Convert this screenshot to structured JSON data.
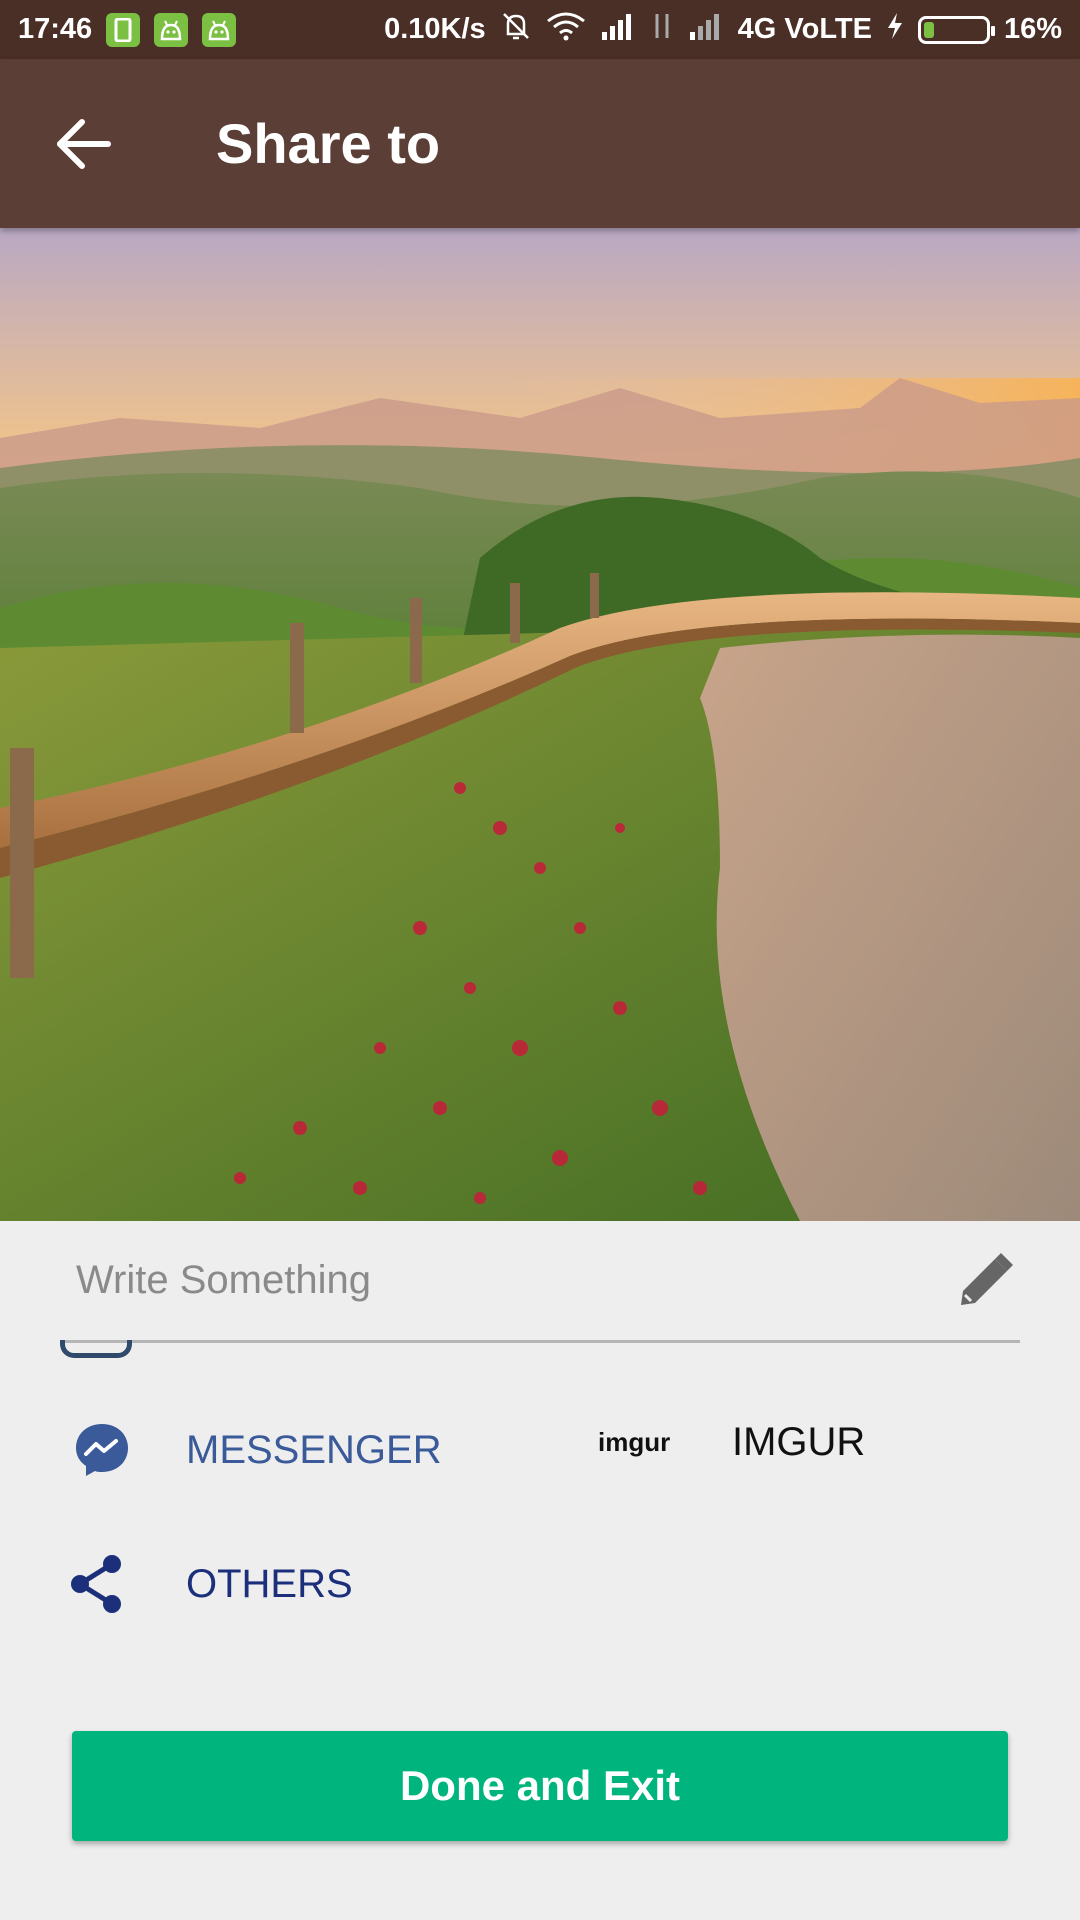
{
  "status_bar": {
    "time": "17:46",
    "network_speed": "0.10K/s",
    "network_type": "4G VoLTE",
    "battery": "16%",
    "battery_level": 0.16,
    "notification_icons": [
      "phone-notification-icon",
      "android-notification-icon",
      "android-notification-icon"
    ]
  },
  "header": {
    "title": "Share to",
    "back_icon": "arrow-left-icon"
  },
  "preview": {
    "image": "landscape-photo-sunset-hills-road"
  },
  "caption": {
    "placeholder": "Write Something",
    "value": "",
    "icon": "pencil-icon"
  },
  "share_options": {
    "messenger": {
      "label": "MESSENGER",
      "icon": "messenger-icon",
      "color": "#3b5a9a"
    },
    "imgur": {
      "label": "IMGUR",
      "logo_text": "imgur",
      "color": "#111111"
    },
    "others": {
      "label": "OTHERS",
      "icon": "share-icon",
      "color": "#1c2f7a"
    }
  },
  "done_button": {
    "label": "Done and Exit",
    "color": "#00b47d"
  },
  "colors": {
    "status_bar": "#4a2f27",
    "app_bar": "#5b3e36",
    "background": "#eeeeee"
  }
}
